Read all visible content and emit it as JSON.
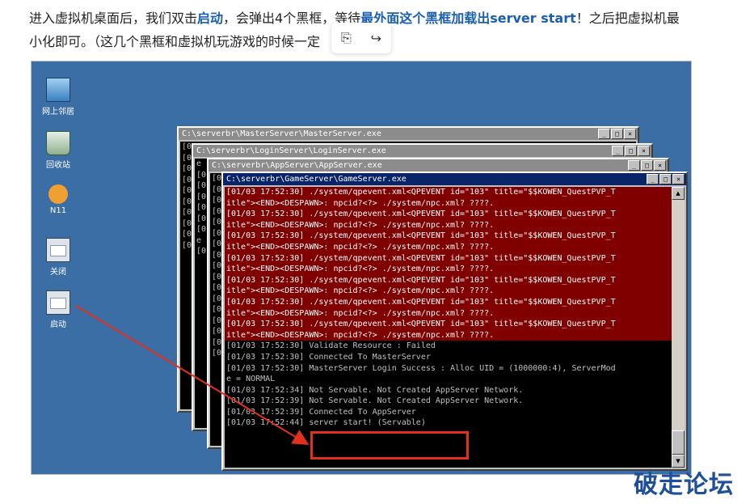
{
  "article": {
    "line1_a": "进入虚拟机桌面后，我们双击",
    "line1_b": "启动",
    "line1_c": "，会弹出4个黑框，等待",
    "line1_d": "最外面这个黑框加载出server start",
    "line1_e": "！之后把虚拟机最",
    "line2": "小化即可。（这几个黑框和虚拟机玩游戏的时候一定"
  },
  "floating_toolbar": {
    "icon1": "link-edit-icon",
    "icon2": "share-icon",
    "glyph1": "⎘",
    "glyph2": "↪"
  },
  "desktop": {
    "icons": [
      {
        "label": "网上邻居",
        "icon": "network-icon"
      },
      {
        "label": "回收站",
        "icon": "recycle-bin-icon"
      },
      {
        "label": "N11",
        "icon": "qq-icon"
      },
      {
        "label": "关闭",
        "icon": "batch-file-icon"
      },
      {
        "label": "启动",
        "icon": "batch-file-icon"
      }
    ]
  },
  "consoles": {
    "master": {
      "title": "C:\\serverbr\\MasterServer\\MasterServer.exe",
      "lines": [
        "[0",
        "[0",
        "[0",
        "[0",
        "[0",
        "[0",
        "[0",
        "[0",
        "[0",
        "[0"
      ]
    },
    "login": {
      "title": "C:\\serverbr\\LoginServer\\LoginServer.exe",
      "lines": [
        "e",
        "[0",
        "[0",
        "[0",
        "[0",
        "[0",
        "[0",
        "e",
        "[0"
      ]
    },
    "app": {
      "title": "C:\\serverbr\\AppServer\\AppServer.exe",
      "lines": [
        "[0",
        "[0",
        "[0",
        "[0",
        "[0",
        "[0",
        "[0",
        "[0",
        "[0",
        "[0",
        "[0",
        "[0",
        "[0",
        "[0",
        "[0",
        "[0",
        "[0"
      ]
    },
    "game": {
      "title": "C:\\serverbr\\GameServer\\GameServer.exe",
      "red_lines": [
        "[01/03 17:52:30] ./system/qpevent.xml<QPEVENT id=\"103\" title=\"$$KOWEN_QuestPVP_T",
        "itle\"><END><DESPAWN>: npcid?<?> ./system/npc.xml? ????.",
        "[01/03 17:52:30] ./system/qpevent.xml<QPEVENT id=\"103\" title=\"$$KOWEN_QuestPVP_T",
        "itle\"><END><DESPAWN>: npcid?<?> ./system/npc.xml? ????.",
        "[01/03 17:52:30] ./system/qpevent.xml<QPEVENT id=\"103\" title=\"$$KOWEN_QuestPVP_T",
        "itle\"><END><DESPAWN>: npcid?<?> ./system/npc.xml? ????.",
        "[01/03 17:52:30] ./system/qpevent.xml<QPEVENT id=\"103\" title=\"$$KOWEN_QuestPVP_T",
        "itle\"><END><DESPAWN>: npcid?<?> ./system/npc.xml? ????.",
        "[01/03 17:52:30] ./system/qpevent.xml<QPEVENT id=\"103\" title=\"$$KOWEN_QuestPVP_T",
        "itle\"><END><DESPAWN>: npcid?<?> ./system/npc.xml? ????.",
        "[01/03 17:52:30] ./system/qpevent.xml<QPEVENT id=\"103\" title=\"$$KOWEN_QuestPVP_T",
        "itle\"><END><DESPAWN>: npcid?<?> ./system/npc.xml? ????.",
        "[01/03 17:52:30] ./system/qpevent.xml<QPEVENT id=\"103\" title=\"$$KOWEN_QuestPVP_T",
        "itle\"><END><DESPAWN>: npcid?<?> ./system/npc.xml? ????."
      ],
      "normal_lines": [
        "[01/03 17:52:30] Validate Resource : Failed",
        "[01/03 17:52:30] Connected To MasterServer",
        "[01/03 17:52:30] MasterServer Login Success : Alloc UID = (1000000:4), ServerMod",
        "e = NORMAL",
        "[01/03 17:52:34] Not Servable. Not Created AppServer Network.",
        "[01/03 17:52:39] Not Servable. Not Created AppServer Network.",
        "[01/03 17:52:39] Connected To AppServer",
        "[01/03 17:52:44] server start! (Servable)"
      ]
    }
  },
  "window_buttons": {
    "min": "_",
    "max": "□",
    "close": "×"
  },
  "scroll_arrows": {
    "up": "▲",
    "down": "▼"
  },
  "watermark": "破走论坛"
}
